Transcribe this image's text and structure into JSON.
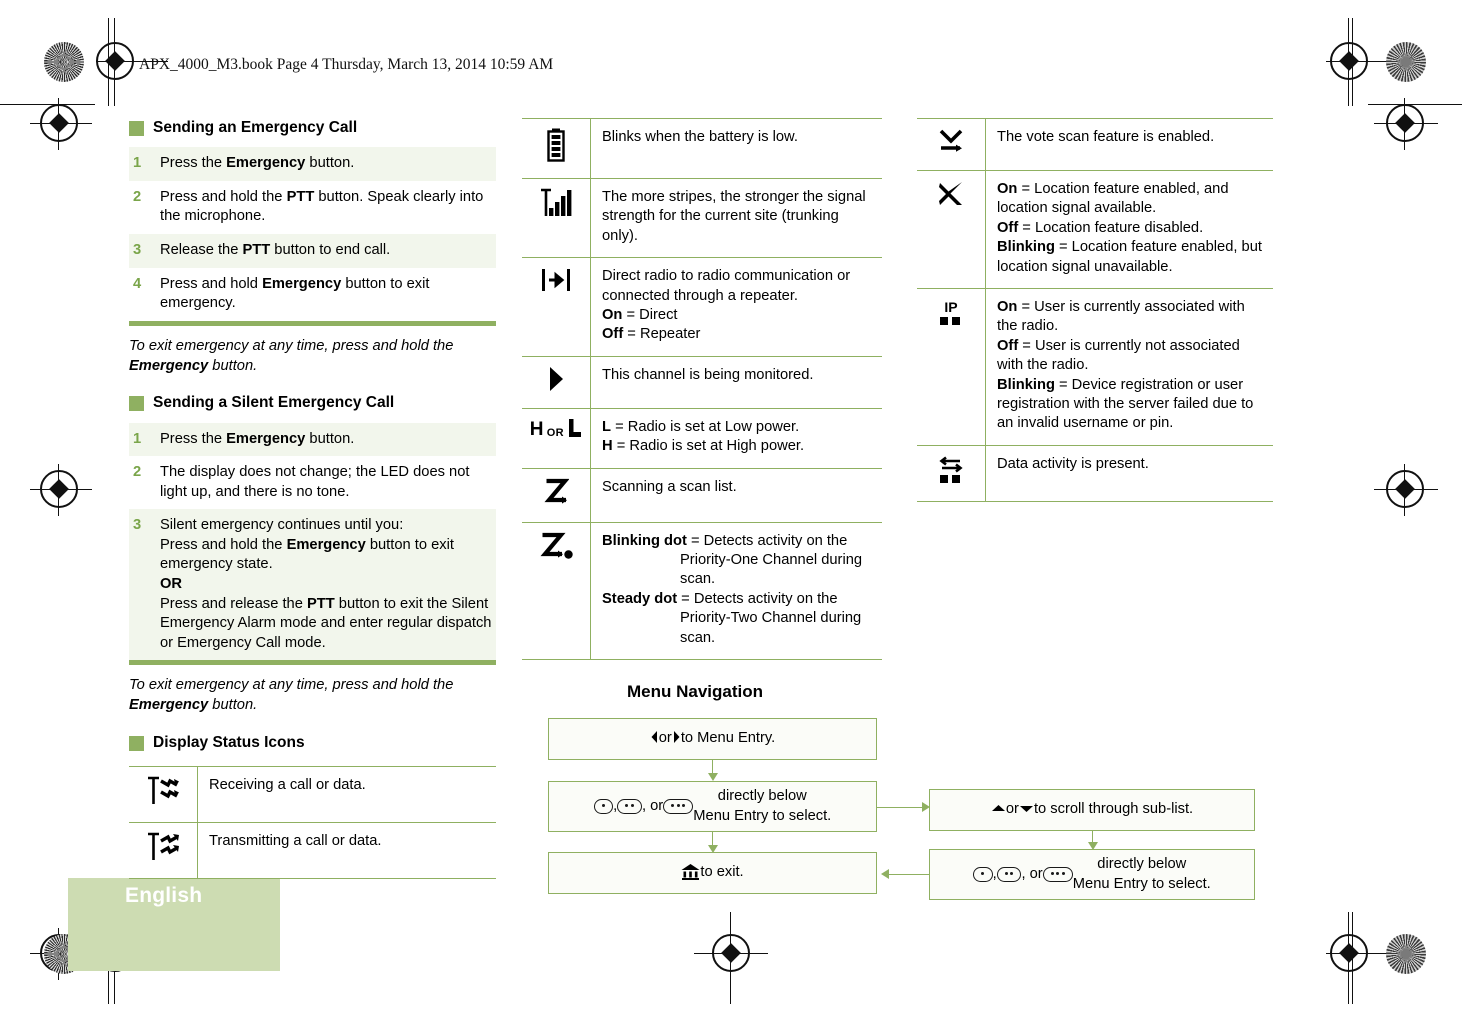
{
  "page_header": "APX_4000_M3.book  Page 4  Thursday, March 13, 2014  10:59 AM",
  "footer": {
    "language": "English"
  },
  "colors": {
    "accent_green": "#8fb061",
    "rule_green": "#8fb061",
    "row_tint": "#f2f6ec",
    "step_number": "#7aa54a",
    "lang_tab": "#cddcb2"
  },
  "left_column": {
    "sections": [
      {
        "heading": "Sending an Emergency Call",
        "steps": [
          {
            "num": "1",
            "parts": [
              {
                "t": "Press the "
              },
              {
                "t": "Emergency",
                "b": true
              },
              {
                "t": " button."
              }
            ]
          },
          {
            "num": "2",
            "parts": [
              {
                "t": "Press and hold the "
              },
              {
                "t": "PTT",
                "b": true
              },
              {
                "t": " button. Speak clearly into the microphone."
              }
            ]
          },
          {
            "num": "3",
            "parts": [
              {
                "t": "Release the "
              },
              {
                "t": "PTT",
                "b": true
              },
              {
                "t": " button to end call."
              }
            ]
          },
          {
            "num": "4",
            "parts": [
              {
                "t": "Press and hold "
              },
              {
                "t": "Emergency",
                "b": true
              },
              {
                "t": " button to exit emergency."
              }
            ]
          }
        ],
        "note_parts": [
          {
            "t": "To exit emergency at any time, press and hold the "
          },
          {
            "t": "Emergency",
            "b": true
          },
          {
            "t": " button."
          }
        ]
      },
      {
        "heading": "Sending a Silent Emergency Call",
        "steps": [
          {
            "num": "1",
            "parts": [
              {
                "t": "Press the "
              },
              {
                "t": "Emergency",
                "b": true
              },
              {
                "t": " button."
              }
            ]
          },
          {
            "num": "2",
            "parts": [
              {
                "t": "The display does not change; the LED does not light up, and there is no tone."
              }
            ]
          },
          {
            "num": "3",
            "parts": [
              {
                "t": "Silent emergency continues until you:"
              },
              {
                "br": true
              },
              {
                "t": "Press and hold the "
              },
              {
                "t": "Emergency",
                "b": true
              },
              {
                "t": " button to exit emergency state."
              },
              {
                "br": true
              },
              {
                "t": "OR",
                "b": true
              },
              {
                "br": true
              },
              {
                "t": "Press and release the "
              },
              {
                "t": "PTT",
                "b": true
              },
              {
                "t": " button to exit the Silent Emergency Alarm mode and enter regular dispatch or Emergency Call mode."
              }
            ]
          }
        ],
        "note_parts": [
          {
            "t": "To exit emergency at any time, press and hold the "
          },
          {
            "t": "Emergency",
            "b": true
          },
          {
            "t": " button."
          }
        ]
      }
    ],
    "status_icons_heading": "Display Status Icons",
    "status_icons": [
      {
        "icon": "receiving-call-or-data-icon",
        "desc_parts": [
          {
            "t": "Receiving a call or data."
          }
        ]
      },
      {
        "icon": "transmitting-call-or-data-icon",
        "desc_parts": [
          {
            "t": "Transmitting a call or data."
          }
        ]
      }
    ]
  },
  "middle_column": {
    "rows": [
      {
        "icon": "battery-icon",
        "desc_parts": [
          {
            "t": "Blinks when the battery is low."
          }
        ]
      },
      {
        "icon": "signal-strength-icon",
        "desc_parts": [
          {
            "t": "The more stripes, the stronger the signal strength for the current site (trunking only)."
          }
        ]
      },
      {
        "icon": "direct-mode-icon",
        "desc_parts": [
          {
            "t": "Direct radio to radio communication or connected through a repeater."
          },
          {
            "br": true
          },
          {
            "t": "On",
            "b": true
          },
          {
            "t": " = Direct"
          },
          {
            "br": true
          },
          {
            "t": "Off",
            "b": true
          },
          {
            "t": " = Repeater"
          }
        ]
      },
      {
        "icon": "monitor-icon",
        "desc_parts": [
          {
            "t": "This channel is being monitored."
          }
        ]
      },
      {
        "icon": "power-level-icon",
        "icon_text": "H OR L",
        "desc_parts": [
          {
            "t": "L",
            "b": true
          },
          {
            "t": " = Radio is set at Low power."
          },
          {
            "br": true
          },
          {
            "t": "H",
            "b": true
          },
          {
            "t": " = Radio is set at High power."
          }
        ]
      },
      {
        "icon": "scan-icon",
        "desc_parts": [
          {
            "t": "Scanning a scan list."
          }
        ]
      },
      {
        "icon": "priority-scan-icon",
        "desc_parts": [
          {
            "t": "Blinking dot",
            "b": true
          },
          {
            "t": " = Detects activity on the Priority-One Channel during scan."
          },
          {
            "br": true
          },
          {
            "t": "Steady dot",
            "b": true
          },
          {
            "t": " = Detects activity on the Priority-Two Channel during scan."
          }
        ],
        "hanging": true
      }
    ]
  },
  "right_column": {
    "rows": [
      {
        "icon": "vote-scan-icon",
        "desc_parts": [
          {
            "t": "The vote scan feature is enabled."
          }
        ]
      },
      {
        "icon": "location-gps-icon",
        "desc_parts": [
          {
            "t": "On",
            "b": true
          },
          {
            "t": " = Location feature enabled, and location signal available."
          },
          {
            "br": true
          },
          {
            "t": "Off",
            "b": true
          },
          {
            "t": " = Location feature disabled."
          },
          {
            "br": true
          },
          {
            "t": "Blinking",
            "b": true
          },
          {
            "t": " = Location feature enabled, but location signal unavailable."
          }
        ]
      },
      {
        "icon": "ip-user-association-icon",
        "desc_parts": [
          {
            "t": "On",
            "b": true
          },
          {
            "t": " = User is currently associated with the radio."
          },
          {
            "br": true
          },
          {
            "t": "Off",
            "b": true
          },
          {
            "t": " = User is currently not associated with the radio."
          },
          {
            "br": true
          },
          {
            "t": "Blinking",
            "b": true
          },
          {
            "t": " = Device registration or user registration with the server failed due to an invalid username or pin."
          }
        ]
      },
      {
        "icon": "data-activity-icon",
        "desc_parts": [
          {
            "t": "Data activity is present."
          }
        ]
      }
    ]
  },
  "menu_navigation": {
    "title": "Menu Navigation",
    "box_left_1_parts": [
      {
        "icon": "left-arrow-glyph"
      },
      {
        "t": " or "
      },
      {
        "icon": "right-arrow-glyph"
      },
      {
        "t": " to Menu Entry."
      }
    ],
    "box_left_2_parts": [
      {
        "icon": "softkey-1-dot"
      },
      {
        "t": ", "
      },
      {
        "icon": "softkey-2-dot"
      },
      {
        "t": ", or "
      },
      {
        "icon": "softkey-3-dot"
      },
      {
        "t": " directly below"
      },
      {
        "br": true
      },
      {
        "t": "Menu Entry to select."
      }
    ],
    "box_left_3_parts": [
      {
        "icon": "home-glyph"
      },
      {
        "t": " to exit."
      }
    ],
    "box_right_1_parts": [
      {
        "icon": "up-arrow-glyph"
      },
      {
        "t": " or "
      },
      {
        "icon": "down-arrow-glyph"
      },
      {
        "t": " to scroll through sub-list."
      }
    ],
    "box_right_2_parts": [
      {
        "icon": "softkey-1-dot"
      },
      {
        "t": ", "
      },
      {
        "icon": "softkey-2-dot"
      },
      {
        "t": ", or "
      },
      {
        "icon": "softkey-3-dot"
      },
      {
        "t": " directly below"
      },
      {
        "br": true
      },
      {
        "t": "Menu Entry to select."
      }
    ]
  }
}
